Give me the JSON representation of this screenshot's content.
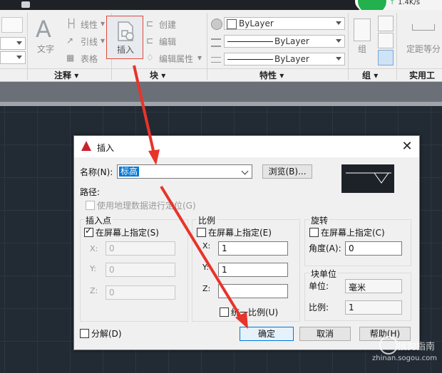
{
  "net": {
    "speed": "1.4K/s",
    "arrow": "↑"
  },
  "ribbon": {
    "annotation": {
      "text_label": "文字",
      "linear": "线性",
      "leader": "引线",
      "table": "表格",
      "panel": "注释"
    },
    "block": {
      "insert": "插入",
      "create": "创建",
      "edit": "编辑",
      "edit_attr": "编辑属性",
      "panel": "块"
    },
    "properties": {
      "layer1": "ByLayer",
      "layer2": "ByLayer",
      "layer3": "ByLayer",
      "panel": "特性"
    },
    "group": {
      "group": "组",
      "panel": "组"
    },
    "utilities": {
      "measure": "定距等分",
      "panel": "实用工具"
    }
  },
  "dialog": {
    "title": "插入",
    "name_label": "名称(N):",
    "name_value": "标高",
    "browse": "浏览(B)...",
    "path_label": "路径:",
    "geo_label": "使用地理数据进行定位(G)",
    "insertion": {
      "title": "插入点",
      "specify": "在屏幕上指定(S)",
      "x_label": "X:",
      "x": "0",
      "y_label": "Y:",
      "y": "0",
      "z_label": "Z:",
      "z": "0"
    },
    "scale": {
      "title": "比例",
      "specify": "在屏幕上指定(E)",
      "x_label": "X:",
      "x": "1",
      "y_label": "Y:",
      "y": "1",
      "z_label": "Z:",
      "z": "",
      "uniform": "统一比例(U)"
    },
    "rotation": {
      "title": "旋转",
      "specify": "在屏幕上指定(C)",
      "angle_label": "角度(A):",
      "angle": "0"
    },
    "unit": {
      "title": "块单位",
      "unit_label": "单位:",
      "unit_value": "毫米",
      "factor_label": "比例:",
      "factor_value": "1"
    },
    "explode": "分解(D)",
    "ok": "确定",
    "cancel": "取消",
    "help": "帮助(H)"
  },
  "watermark": {
    "brand": "搜狗指南",
    "url": "zhinan.sogou.com"
  },
  "colors": {
    "accent": "#0078d7",
    "highlight": "#e04a3a",
    "canvas": "#222a33"
  }
}
